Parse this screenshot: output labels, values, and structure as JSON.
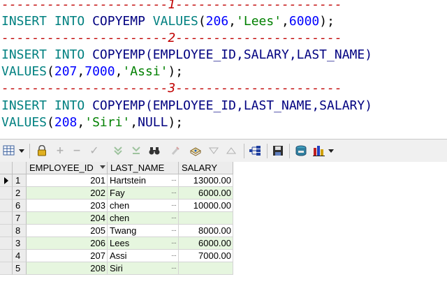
{
  "editor": {
    "lines": [
      {
        "comment": "----------------------1----------------------"
      },
      {
        "kw1": "INSERT",
        "kw2": "INTO",
        "obj": "COPYEMP",
        "kw3": "VALUES",
        "open": "(",
        "n1": "206",
        "c1": ",",
        "s1": "'Lees'",
        "c2": ",",
        "n2": "6000",
        "end": ");"
      },
      {
        "comment": "----------------------2----------------------"
      },
      {
        "kw1": "INSERT",
        "kw2": "INTO",
        "obj": "COPYEMP",
        "cols": "(EMPLOYEE_ID,SALARY,LAST_NAME)"
      },
      {
        "kw": "VALUES",
        "open": "(",
        "n1": "207",
        "c1": ",",
        "n2": "7000",
        "c2": ",",
        "s1": "'Assi'",
        "end": ");"
      },
      {
        "comment": "----------------------3----------------------"
      },
      {
        "kw1": "INSERT",
        "kw2": "INTO",
        "obj": "COPYEMP",
        "cols": "(EMPLOYEE_ID,LAST_NAME,SALARY)"
      },
      {
        "kw": "VALUES",
        "open": "(",
        "n1": "208",
        "c1": ",",
        "s1": "'Siri'",
        "c2": ",",
        "nul": "NULL",
        "end": ");"
      }
    ]
  },
  "toolbar": {
    "icons": [
      "grid-options-icon",
      "dropdown-arrow-icon",
      "lock-icon",
      "add-record-icon",
      "delete-record-icon",
      "post-edit-icon",
      "filter-down-icon",
      "filter-clear-icon",
      "find-icon",
      "clear-icon",
      "query-by-example-icon",
      "navigate-down-icon",
      "navigate-up-icon",
      "tree-view-icon",
      "save-icon",
      "export-icon",
      "chart-icon",
      "dropdown-arrow-icon"
    ]
  },
  "grid": {
    "columns": [
      "EMPLOYEE_ID",
      "LAST_NAME",
      "SALARY"
    ],
    "ellipsis": "···",
    "rows": [
      {
        "rn": "1",
        "id": "201",
        "name": "Hartstein",
        "salary": "13000.00"
      },
      {
        "rn": "2",
        "id": "202",
        "name": "Fay",
        "salary": "6000.00"
      },
      {
        "rn": "6",
        "id": "203",
        "name": "chen",
        "salary": "10000.00"
      },
      {
        "rn": "7",
        "id": "204",
        "name": "chen",
        "salary": ""
      },
      {
        "rn": "8",
        "id": "205",
        "name": "Twang",
        "salary": "8000.00"
      },
      {
        "rn": "3",
        "id": "206",
        "name": "Lees",
        "salary": "6000.00"
      },
      {
        "rn": "4",
        "id": "207",
        "name": "Assi",
        "salary": "7000.00"
      },
      {
        "rn": "5",
        "id": "208",
        "name": "Siri",
        "salary": ""
      }
    ],
    "colors": {
      "alt_row": "#e6f6df",
      "header": "#ececec"
    }
  }
}
